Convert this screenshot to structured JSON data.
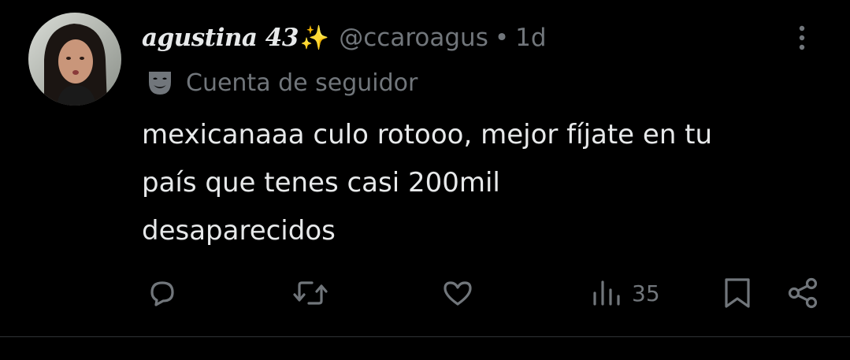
{
  "tweet": {
    "author": {
      "display_name": "agustina 43",
      "emoji": "✨",
      "handle": "@ccaroagus",
      "separator": "•",
      "timestamp": "1d"
    },
    "context": {
      "icon": "mask-icon",
      "label": "Cuenta de seguidor"
    },
    "body_lines": [
      "mexicanaaa culo rotooo, mejor fíjate en tu",
      "país que tenes casi 200mil",
      "desaparecidos"
    ],
    "actions": {
      "reply_icon": "reply-icon",
      "retweet_icon": "retweet-icon",
      "like_icon": "heart-icon",
      "views_icon": "views-icon",
      "views_count": "35",
      "bookmark_icon": "bookmark-icon",
      "share_icon": "share-icon"
    }
  },
  "colors": {
    "background": "#000000",
    "primary_text": "#e7e9ea",
    "secondary_text": "#71767b",
    "divider": "#2f3336"
  }
}
